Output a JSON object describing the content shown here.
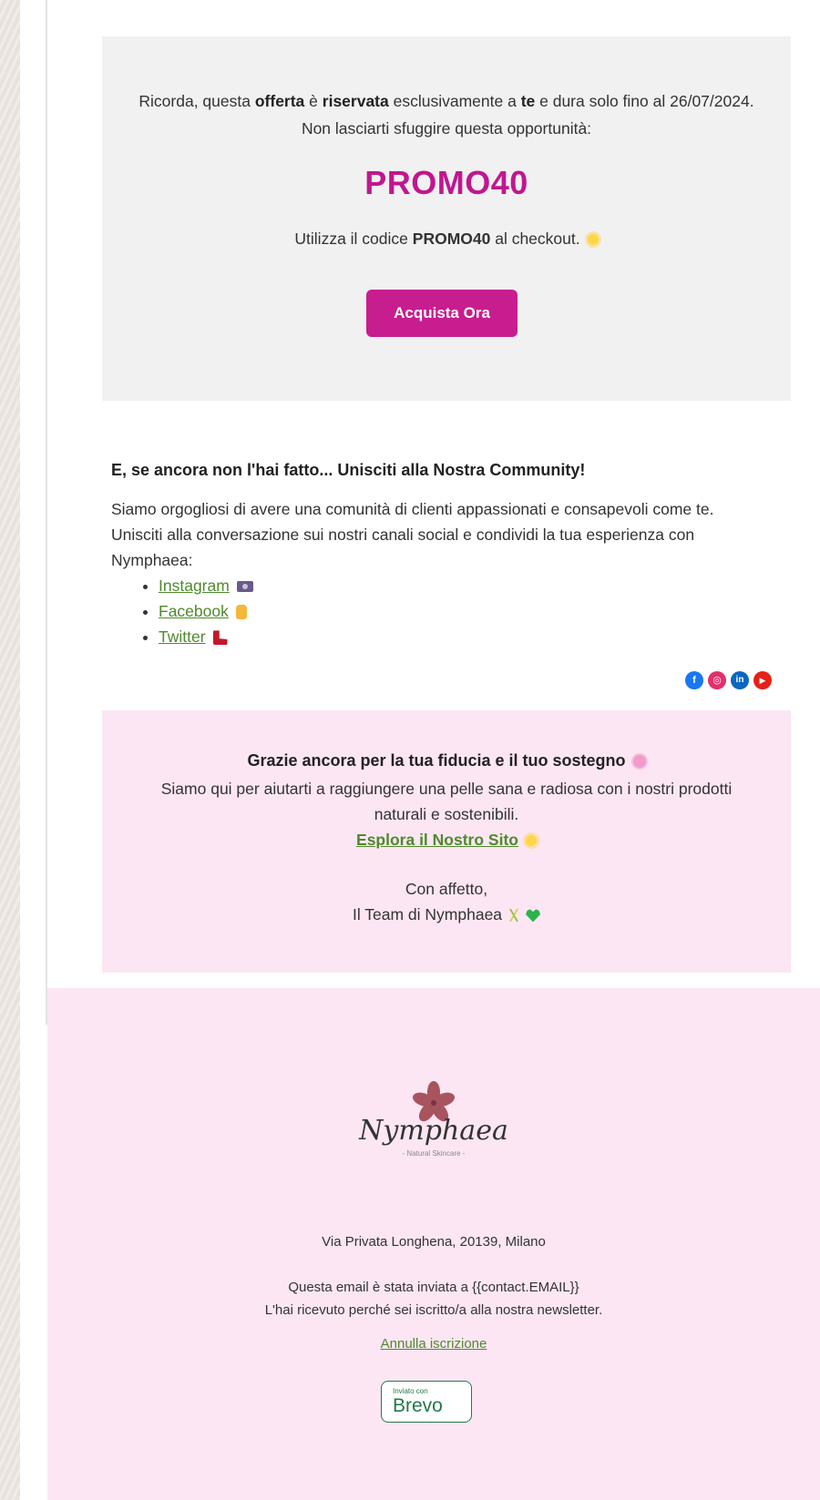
{
  "promo": {
    "intro_1": "Ricorda, questa ",
    "intro_b1": "offerta",
    "intro_2": " è ",
    "intro_b2": "riservata",
    "intro_3": " esclusivamente a ",
    "intro_b3": "te",
    "intro_4": " e dura solo fino al 26/07/2024. Non lasciarti sfuggire questa opportunità:",
    "code_big": "PROMO40",
    "use_1": "Utilizza il codice ",
    "use_code": "PROMO40",
    "use_2": " al checkout.",
    "cta_label": "Acquista Ora"
  },
  "community": {
    "title": "E, se ancora non l'hai fatto... Unisciti alla Nostra Community!",
    "body": "Siamo orgogliosi di avere una comunità di clienti appassionati e consapevoli come te. Unisciti alla conversazione sui nostri canali social e condividi la tua esperienza con Nymphaea:",
    "links": [
      "Instagram",
      "Facebook",
      "Twitter"
    ]
  },
  "social_icons": [
    {
      "name": "facebook",
      "glyph": "f",
      "color": "#1877f2"
    },
    {
      "name": "instagram",
      "glyph": "◎",
      "color": "#e1306c"
    },
    {
      "name": "linkedin",
      "glyph": "in",
      "color": "#0a66c2"
    },
    {
      "name": "youtube",
      "glyph": "▶",
      "color": "#e62117"
    }
  ],
  "thanks": {
    "title": "Grazie ancora per la tua fiducia e il tuo sostegno",
    "body": "Siamo qui per aiutarti a raggiungere una pelle sana e radiosa con i nostri prodotti naturali e sostenibili.",
    "link": "Esplora il Nostro Sito",
    "sign_1": "Con affetto,",
    "sign_2": "Il Team di Nymphaea"
  },
  "footer": {
    "logo_text": "Nymphaea",
    "logo_sub": "- Natural Skincare -",
    "address": "Via Privata Longhena, 20139, Milano",
    "sent_to": "Questa email è stata inviata a {{contact.EMAIL}}",
    "reason": "L'hai ricevuto perché sei iscritto/a alla nostra newsletter.",
    "unsubscribe": "Annulla iscrizione",
    "brevo_small": "Inviato con",
    "brevo_big": "Brevo"
  },
  "colors": {
    "accent": "#c71d8f",
    "link": "#4e8a2d",
    "pink_bg": "#fce6f3"
  }
}
